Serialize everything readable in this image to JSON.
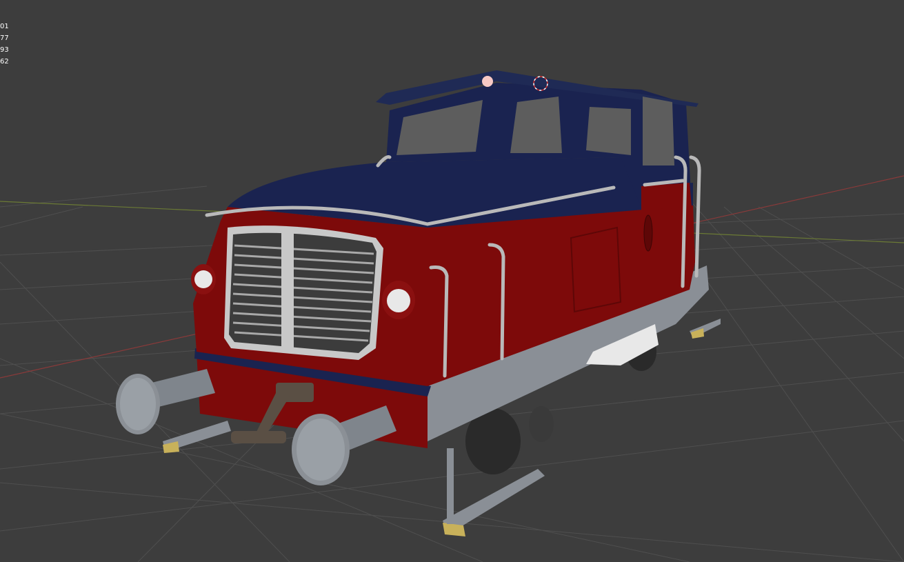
{
  "viewport": {
    "background": "#3d3d3d",
    "grid_color": "#4f4f4f",
    "axis_x_color": "#8a3a3a",
    "axis_y_color": "#6b7a35"
  },
  "overlay_stats": [
    "01",
    "77",
    "93",
    "62"
  ],
  "scene": {
    "object": "locomotive-model",
    "colors": {
      "body_red": "#7d0a0a",
      "cab_blue": "#1a2350",
      "frame_grey": "#8a8f96",
      "buffer_grey": "#8b9096",
      "metal_silver": "#b9b9b9",
      "window_grey": "#5d5d5d",
      "step_yellow": "#c8b15a"
    },
    "icons": [
      "light-origin-icon",
      "3d-cursor-icon"
    ]
  }
}
